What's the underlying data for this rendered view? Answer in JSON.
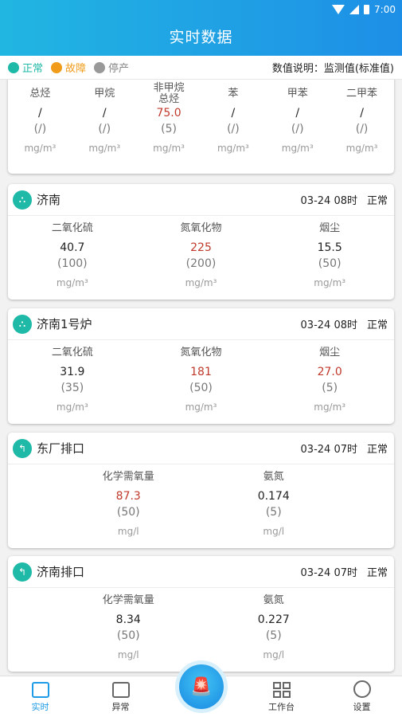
{
  "status_bar": {
    "time": "7:00"
  },
  "header": {
    "title": "实时数据"
  },
  "legend": {
    "normal": "正常",
    "fault": "故障",
    "stop": "停产",
    "description": "数值说明：监测值(标准值)",
    "colors": {
      "normal": "#1fb9a8",
      "fault": "#f09c1a",
      "stop": "#999999"
    }
  },
  "card0": {
    "items": [
      {
        "label": "总烃",
        "value": "/",
        "std": "(/)",
        "unit": "mg/m³"
      },
      {
        "label": "甲烷",
        "value": "/",
        "std": "(/)",
        "unit": "mg/m³"
      },
      {
        "label": "非甲烷\n总烃",
        "value": "75.0",
        "std": "(5)",
        "unit": "mg/m³"
      },
      {
        "label": "苯",
        "value": "/",
        "std": "(/)",
        "unit": "mg/m³"
      },
      {
        "label": "甲苯",
        "value": "/",
        "std": "(/)",
        "unit": "mg/m³"
      },
      {
        "label": "二甲苯",
        "value": "/",
        "std": "(/)",
        "unit": "mg/m³"
      }
    ]
  },
  "card1": {
    "name": "济南",
    "time": "03-24 08时",
    "status": "正常",
    "items": [
      {
        "label": "二氧化硫",
        "value": "40.7",
        "std": "(100)",
        "unit": "mg/m³"
      },
      {
        "label": "氮氧化物",
        "value": "225",
        "std": "(200)",
        "unit": "mg/m³"
      },
      {
        "label": "烟尘",
        "value": "15.5",
        "std": "(50)",
        "unit": "mg/m³"
      }
    ]
  },
  "card2": {
    "name": "济南1号炉",
    "time": "03-24 08时",
    "status": "正常",
    "items": [
      {
        "label": "二氧化硫",
        "value": "31.9",
        "std": "(35)",
        "unit": "mg/m³"
      },
      {
        "label": "氮氧化物",
        "value": "181",
        "std": "(50)",
        "unit": "mg/m³"
      },
      {
        "label": "烟尘",
        "value": "27.0",
        "std": "(5)",
        "unit": "mg/m³"
      }
    ]
  },
  "card3": {
    "name": "东厂排口",
    "time": "03-24 07时",
    "status": "正常",
    "items": [
      {
        "label": "化学需氧量",
        "value": "87.3",
        "std": "(50)",
        "unit": "mg/l"
      },
      {
        "label": "氨氮",
        "value": "0.174",
        "std": "(5)",
        "unit": "mg/l"
      }
    ]
  },
  "card4": {
    "name": "济南排口",
    "time": "03-24 07时",
    "status": "正常",
    "items": [
      {
        "label": "化学需氧量",
        "value": "8.34",
        "std": "(50)",
        "unit": "mg/l"
      },
      {
        "label": "氨氮",
        "value": "0.227",
        "std": "(5)",
        "unit": "mg/l"
      }
    ]
  },
  "nav": {
    "realtime": "实时",
    "abnormal": "异常",
    "workbench": "工作台",
    "settings": "设置"
  }
}
